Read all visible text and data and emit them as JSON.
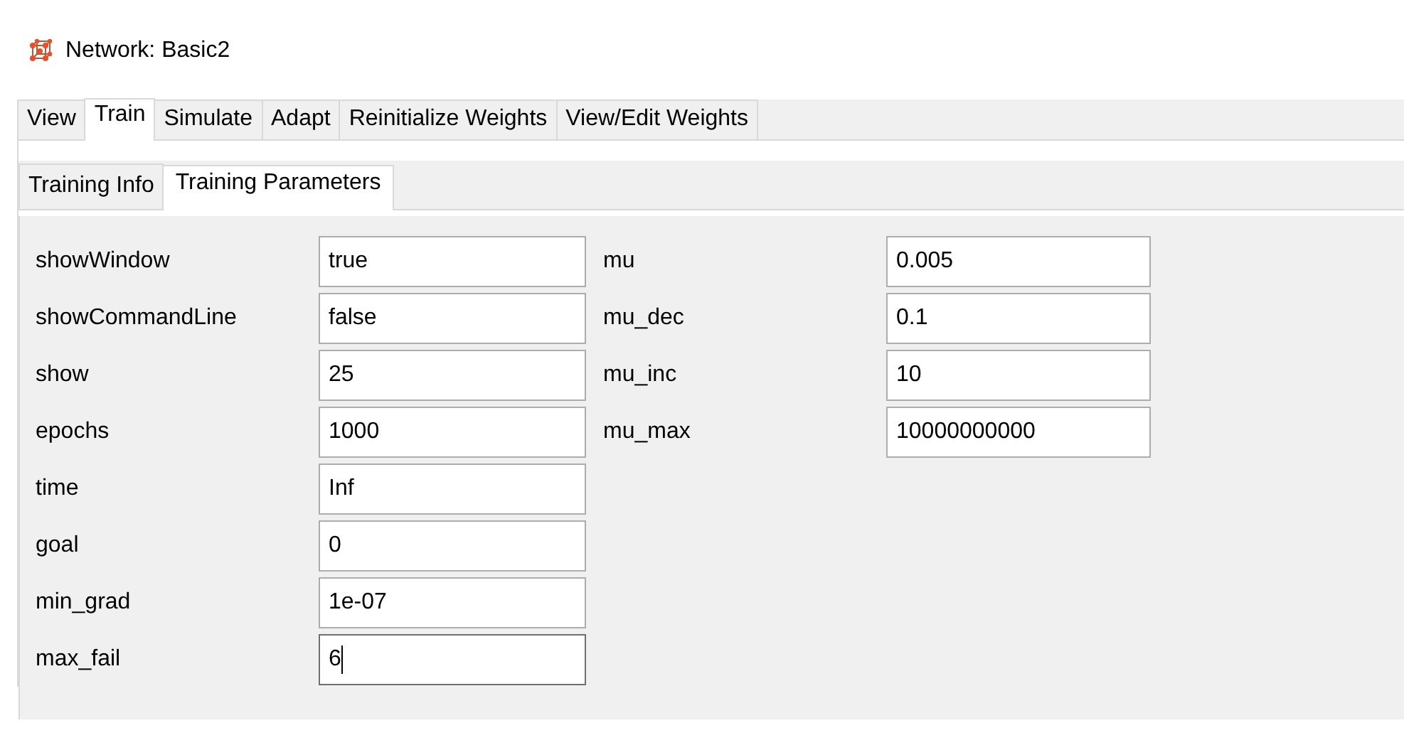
{
  "window": {
    "title": "Network: Basic2"
  },
  "tabs": [
    {
      "label": "View",
      "selected": false
    },
    {
      "label": "Train",
      "selected": true
    },
    {
      "label": "Simulate",
      "selected": false
    },
    {
      "label": "Adapt",
      "selected": false
    },
    {
      "label": "Reinitialize Weights",
      "selected": false
    },
    {
      "label": "View/Edit Weights",
      "selected": false
    }
  ],
  "subtabs": [
    {
      "label": "Training Info",
      "selected": false
    },
    {
      "label": "Training Parameters",
      "selected": true
    }
  ],
  "parameter_columns": [
    [
      {
        "name": "showWindow",
        "value": "true",
        "focused": false
      },
      {
        "name": "showCommandLine",
        "value": "false",
        "focused": false
      },
      {
        "name": "show",
        "value": "25",
        "focused": false
      },
      {
        "name": "epochs",
        "value": "1000",
        "focused": false
      },
      {
        "name": "time",
        "value": "Inf",
        "focused": false
      },
      {
        "name": "goal",
        "value": "0",
        "focused": false
      },
      {
        "name": "min_grad",
        "value": "1e-07",
        "focused": false
      },
      {
        "name": "max_fail",
        "value": "6",
        "focused": true
      }
    ],
    [
      {
        "name": "mu",
        "value": "0.005",
        "focused": false
      },
      {
        "name": "mu_dec",
        "value": "0.1",
        "focused": false
      },
      {
        "name": "mu_inc",
        "value": "10",
        "focused": false
      },
      {
        "name": "mu_max",
        "value": "10000000000",
        "focused": false
      }
    ]
  ]
}
